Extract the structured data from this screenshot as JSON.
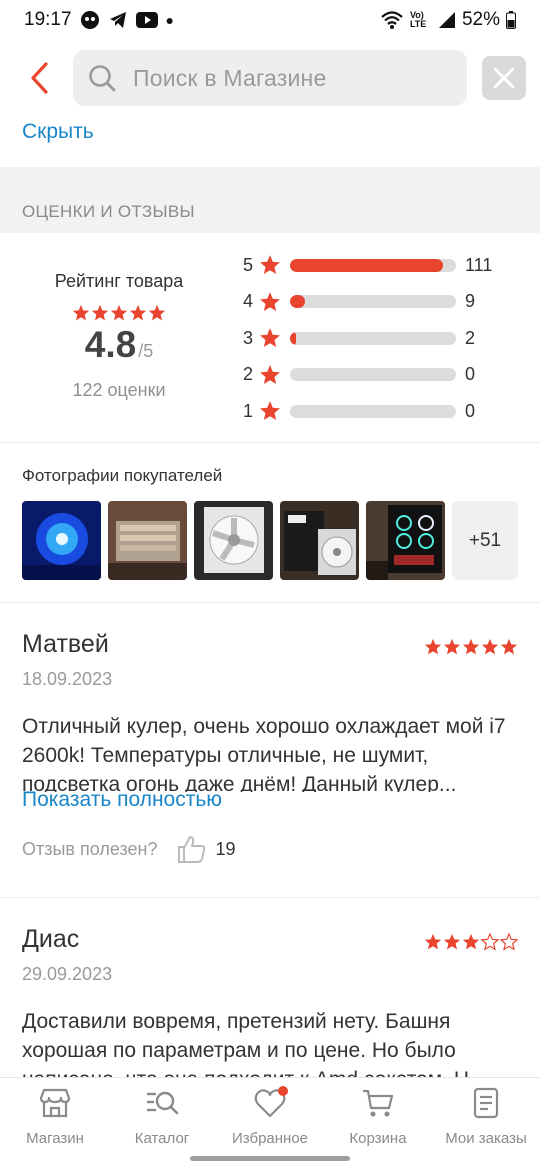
{
  "status_bar": {
    "time": "19:17",
    "battery": "52%",
    "network": "Vo) LTE"
  },
  "header": {
    "search_placeholder": "Поиск в Магазине"
  },
  "hide_link": "Скрыть",
  "section_title": "ОЦЕНКИ И ОТЗЫВЫ",
  "rating": {
    "title": "Рейтинг товара",
    "value": "4.8",
    "max": "/5",
    "count_text": "122 оценки",
    "stars": 4.8,
    "distribution": [
      {
        "stars": "5",
        "count": "111",
        "fraction": 0.92
      },
      {
        "stars": "4",
        "count": "9",
        "fraction": 0.09
      },
      {
        "stars": "3",
        "count": "2",
        "fraction": 0.03
      },
      {
        "stars": "2",
        "count": "0",
        "fraction": 0
      },
      {
        "stars": "1",
        "count": "0",
        "fraction": 0
      }
    ]
  },
  "photos": {
    "title": "Фотографии покупателей",
    "more_label": "+51"
  },
  "reviews": [
    {
      "author": "Матвей",
      "date": "18.09.2023",
      "stars": 5,
      "text": "Отличный кулер, очень хорошо охлаждает мой i7 2600k! Температуры отличные, не шумит, подсветка огонь даже днём! Данный кулер...",
      "show_more": "Показать полностью",
      "helpful_label": "Отзыв полезен?",
      "helpful_count": "19"
    },
    {
      "author": "Диас",
      "date": "29.09.2023",
      "stars": 3,
      "text": "Доставили вовремя, претензий нету. Башня хорошая по параметрам и по цене. Но было написано, что она подходит к Amd сокетам. Н"
    }
  ],
  "bottom_nav": [
    {
      "label": "Магазин",
      "icon": "shop-icon"
    },
    {
      "label": "Каталог",
      "icon": "catalog-icon"
    },
    {
      "label": "Избранное",
      "icon": "heart-icon"
    },
    {
      "label": "Корзина",
      "icon": "cart-icon"
    },
    {
      "label": "Мои заказы",
      "icon": "orders-icon"
    }
  ],
  "colors": {
    "accent_red": "#e8442e",
    "link_blue": "#1a86c8"
  }
}
